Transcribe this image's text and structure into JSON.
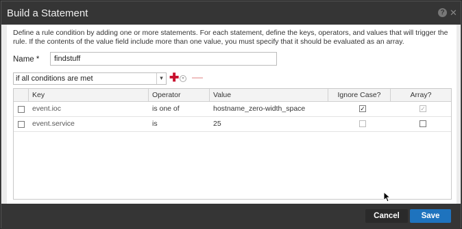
{
  "dialog": {
    "title": "Build a Statement",
    "description": "Define a rule condition by adding one or more statements. For each statement, define the keys, operators, and values that will trigger the rule. If the contents of the value field include more than one value, you must specify that it should be evaluated as an array.",
    "name_label": "Name *",
    "name_value": "findstuff",
    "condition_value": "if all conditions are met",
    "icons": {
      "help": "help-icon",
      "close": "close-icon",
      "add": "plus-icon",
      "add_menu": "chevron-down-icon",
      "remove": "minus-icon"
    },
    "colors": {
      "titlebar": "#353535",
      "add": "#c8102e",
      "remove": "#e08a8a",
      "save": "#1e73be"
    }
  },
  "grid": {
    "headers": [
      "Key",
      "Operator",
      "Value",
      "Ignore Case?",
      "Array?"
    ],
    "rows": [
      {
        "key": "event.ioc",
        "operator": "is one of",
        "value": "hostname_zero-width_space",
        "ignore_case": true,
        "ignore_case_enabled": true,
        "array": true,
        "array_enabled": false
      },
      {
        "key": "event.service",
        "operator": "is",
        "value": "25",
        "ignore_case": false,
        "ignore_case_enabled": false,
        "array": false,
        "array_enabled": true
      }
    ]
  },
  "footer": {
    "cancel_label": "Cancel",
    "save_label": "Save"
  }
}
